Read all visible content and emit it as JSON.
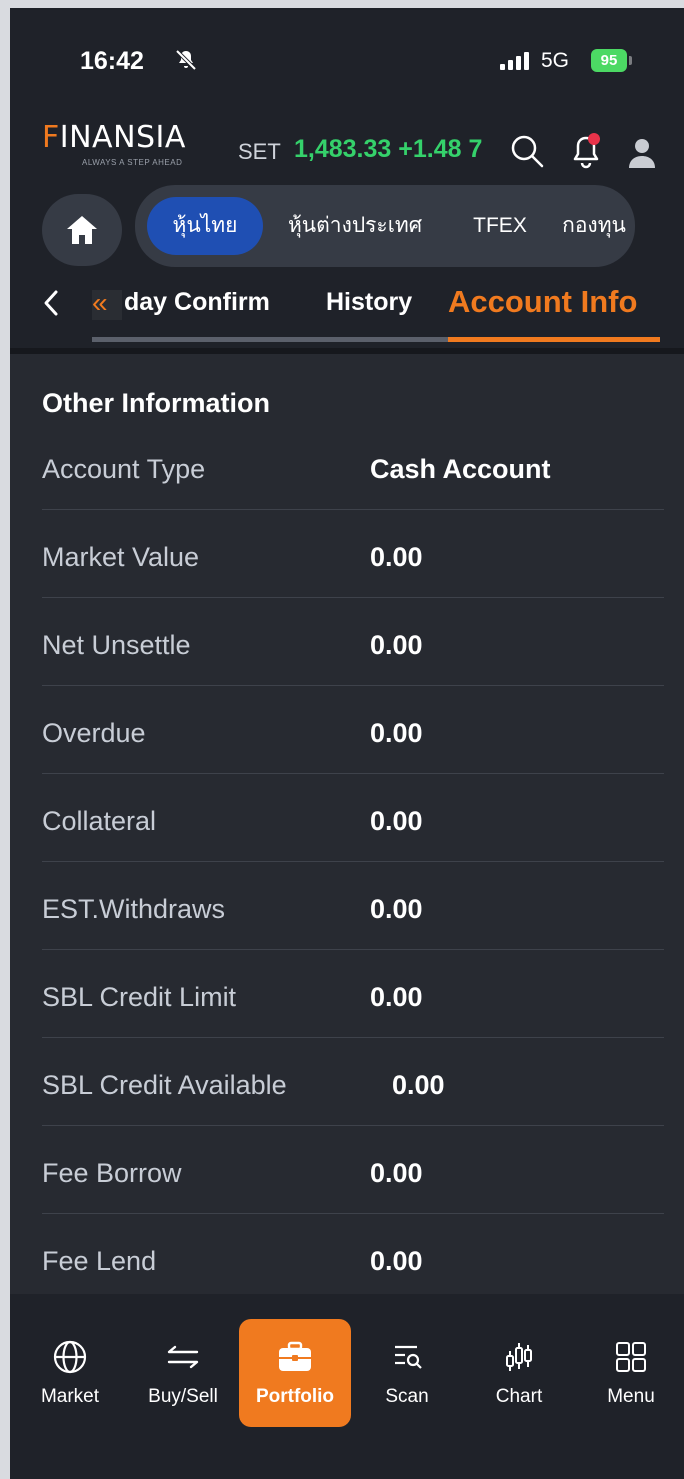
{
  "status_bar": {
    "time": "16:42",
    "network": "5G",
    "battery": "95"
  },
  "header": {
    "logo": "FINANSIA",
    "logo_tagline": "ALWAYS A STEP AHEAD",
    "index_name": "SET",
    "index_value": "1,483.33 +1.48 7"
  },
  "market_tabs": [
    {
      "label": "หุ้นไทย",
      "active": true
    },
    {
      "label": "หุ้นต่างประเทศ",
      "active": false
    },
    {
      "label": "TFEX",
      "active": false
    },
    {
      "label": "กองทุน",
      "active": false
    }
  ],
  "sub_tabs": [
    {
      "label": "day Confirm",
      "active": false
    },
    {
      "label": "History",
      "active": false
    },
    {
      "label": "Account Info",
      "active": true
    }
  ],
  "section": {
    "title": "Other Information",
    "rows": [
      {
        "label": "Account Type",
        "value": "Cash Account"
      },
      {
        "label": "Market Value",
        "value": "0.00"
      },
      {
        "label": "Net Unsettle",
        "value": "0.00"
      },
      {
        "label": "Overdue",
        "value": "0.00"
      },
      {
        "label": "Collateral",
        "value": "0.00"
      },
      {
        "label": "EST.Withdraws",
        "value": "0.00"
      },
      {
        "label": "SBL Credit Limit",
        "value": "0.00"
      },
      {
        "label": "SBL Credit Available",
        "value": "0.00"
      },
      {
        "label": "Fee Borrow",
        "value": "0.00"
      },
      {
        "label": "Fee Lend",
        "value": "0.00"
      }
    ]
  },
  "bottom_nav": [
    {
      "label": "Market",
      "icon": "globe-icon",
      "active": false
    },
    {
      "label": "Buy/Sell",
      "icon": "swap-arrows-icon",
      "active": false
    },
    {
      "label": "Portfolio",
      "icon": "briefcase-icon",
      "active": true
    },
    {
      "label": "Scan",
      "icon": "scan-filter-icon",
      "active": false
    },
    {
      "label": "Chart",
      "icon": "candlestick-icon",
      "active": false
    },
    {
      "label": "Menu",
      "icon": "grid-icon",
      "active": false
    }
  ],
  "colors": {
    "accent": "#f07a1f",
    "positive": "#35d16b",
    "active_tab": "#1f4fb3",
    "background": "#272a31"
  }
}
